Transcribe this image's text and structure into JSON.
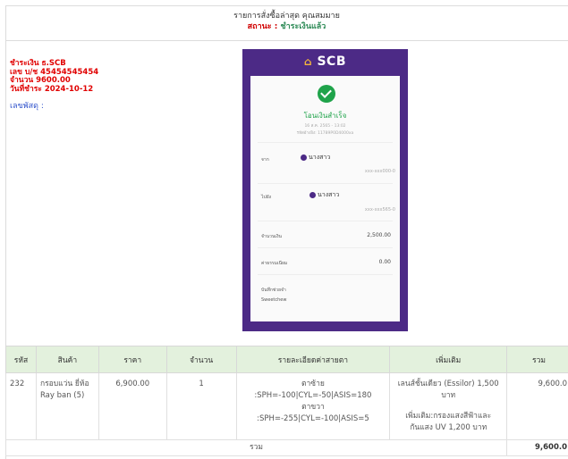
{
  "header": {
    "title": "รายการสั่งซื้อล่าสุด คุณสมมาย",
    "status_label": "สถานะ :",
    "status_value": "ชำระเงินแล้ว"
  },
  "payment": {
    "bank": "ชำระเงิน ธ.SCB",
    "account": "เลข บ/ช 45454545454",
    "amount": "จำนวน 9600.00",
    "date": "วันที่ชำระ 2024-10-12"
  },
  "tracking_label": "เลขพัสดุ :",
  "receipt": {
    "logo": "SCB",
    "success": "โอนเงินสำเร็จ",
    "datetime": "16 ส.ค. 2565 - 13:02",
    "ref": "รหัสอ้างอิง: 11789P0D4000xa",
    "from_label": "จาก",
    "from_name": "นางสาว",
    "from_acct": "xxx-xxx000-0",
    "to_label": "ไปยัง",
    "to_name": "นางสาว",
    "to_acct": "xxx-xxx565-0",
    "amount_label": "จำนวนเงิน",
    "amount": "2,500.00",
    "fee_label": "ค่าธรรมเนียม",
    "fee": "0.00",
    "memo_label": "บันทึกช่วยจำ",
    "memo": "Sweetchew"
  },
  "table": {
    "headers": [
      "รหัส",
      "สินค้า",
      "ราคา",
      "จำนวน",
      "รายละเอียดค่าสายตา",
      "เพิ่มเติม",
      "รวม"
    ],
    "row": {
      "code": "232",
      "product": "กรอบแว่น ยี่ห้อ Ray ban (5)",
      "price": "6,900.00",
      "qty": "1",
      "left_label": "ตาซ้าย",
      "left_val": ":SPH=-100|CYL=-50|ASIS=180",
      "right_label": "ตาขวา",
      "right_val": ":SPH=-255|CYL=-100|ASIS=5",
      "extra1": "เลนส์ชั้นเดียว (Essilor) 1,500 บาท",
      "extra2": "เพิ่มเติม:กรองแสงสีฟ้าและกันแสง UV 1,200 บาท",
      "total": "9,600.0"
    },
    "sum_label": "รวม",
    "sum_value": "9,600.0"
  }
}
